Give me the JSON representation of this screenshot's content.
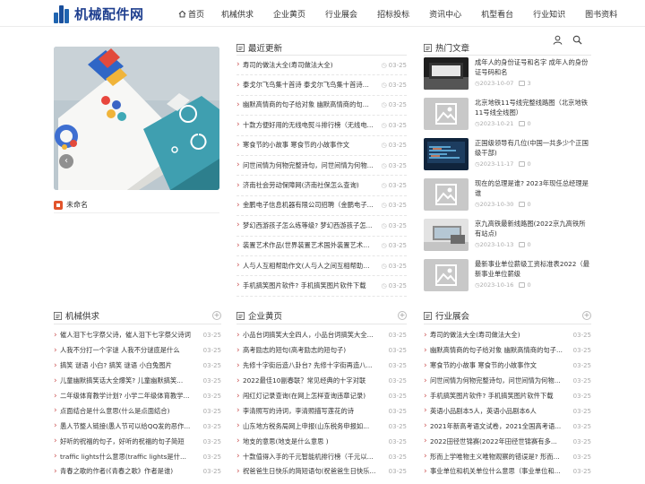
{
  "header": {
    "logo_text": "机械配件网",
    "nav": [
      "首页",
      "机械供求",
      "企业黄页",
      "行业展会",
      "招标投标",
      "资讯中心",
      "机型看台",
      "行业知识",
      "图书资料"
    ]
  },
  "slider": {
    "caption": "未命名"
  },
  "recent": {
    "title": "最近更新",
    "items": [
      {
        "title": "寿司的做法大全(寿司做法大全)",
        "date": "03-25"
      },
      {
        "title": "泰戈尔飞鸟集十首诗 泰戈尔飞鸟集十首诗朗诵",
        "date": "03-25"
      },
      {
        "title": "幽默高情商的句子给对象 幽默高情商的句子...",
        "date": "03-25"
      },
      {
        "title": "十款方便好用的无线电熨斗排行榜（无线电...",
        "date": "03-25"
      },
      {
        "title": "寒食节的小故事 寒食节的小故事作文",
        "date": "03-25"
      },
      {
        "title": "问世间情为何物完整诗句，问世间情为何物...",
        "date": "03-25"
      },
      {
        "title": "济南社会劳动保障网(济南社保怎么查询)",
        "date": "03-25"
      },
      {
        "title": "金鹏电子信息机器有限公司招聘（金鹏电子...",
        "date": "03-25"
      },
      {
        "title": "梦幻西游孩子怎么练等级? 梦幻西游孩子怎...",
        "date": "03-25"
      },
      {
        "title": "装置艺术作品(世界装置艺术国外装置艺术作...",
        "date": "03-25"
      },
      {
        "title": "人与人互相帮助作文(人与人之间互相帮助的...",
        "date": "03-25"
      },
      {
        "title": "手机搞笑图片软件? 手机搞笑图片软件下载",
        "date": "03-25"
      }
    ]
  },
  "hot": {
    "title": "热门文章",
    "items": [
      {
        "title": "成年人的身份证号和名字 成年人的身份证号码和名",
        "date": "2023-10-07",
        "comments": "3"
      },
      {
        "title": "北京地铁11号线完整线路图（北京地铁11号线全线图）",
        "date": "2023-10-21",
        "comments": "0"
      },
      {
        "title": "正国级领导有几位(中国一共多少个正国级干部)",
        "date": "2023-11-17",
        "comments": "0"
      },
      {
        "title": "现在的总理是谁? 2023年现任总经理是谁",
        "date": "2023-10-30",
        "comments": "0"
      },
      {
        "title": "京九高铁最新线路图(2022京九高铁所有站点)",
        "date": "2023-10-13",
        "comments": "0"
      },
      {
        "title": "最新事业单位薪级工资标准表2022（最新事业单位薪级",
        "date": "2023-10-16",
        "comments": "0"
      }
    ]
  },
  "sections": [
    {
      "title": "机械供求",
      "items": [
        {
          "title": "催人泪下七字祭父诗，催人泪下七字祭父诗词",
          "date": "03-25"
        },
        {
          "title": "人我不分打一个字谜 人我不分谜底是什么",
          "date": "03-25"
        },
        {
          "title": "搞笑 谜语 小白? 搞笑 谜语 小白兔图片",
          "date": "03-25"
        },
        {
          "title": "儿童幽默搞笑话大全爆笑? 儿童幽默搞笑...",
          "date": "03-25"
        },
        {
          "title": "二年级体育教学计划? 小学二年级体育教学...",
          "date": "03-25"
        },
        {
          "title": "点面结合是什么意思(什么是点面结合)",
          "date": "03-25"
        },
        {
          "title": "愚人节整人链接(愚人节可以给QQ发的恶作...",
          "date": "03-25"
        },
        {
          "title": "好听的祝福的句子，好听的祝福的句子简短",
          "date": "03-25"
        },
        {
          "title": "traffic lights什么意思(traffic lights是什...",
          "date": "03-25"
        },
        {
          "title": "青春之歌的作者(《青春之歌》作者是谁)",
          "date": "03-25"
        }
      ]
    },
    {
      "title": "企业黄页",
      "items": [
        {
          "title": "小品台词搞笑大全四人，小品台词搞笑大全...",
          "date": "03-25"
        },
        {
          "title": "高考励志的短句(高考励志的短句子)",
          "date": "03-25"
        },
        {
          "title": "先修十字街后造八卦台? 先修十字街再造八...",
          "date": "03-25"
        },
        {
          "title": "2022最佳10副春联？常见经典的十字对联",
          "date": "03-25"
        },
        {
          "title": "闯红灯记录查询(在网上怎样查询违章记录)",
          "date": "03-25"
        },
        {
          "title": "李清照写的诗词，李清照描写莲花的诗",
          "date": "03-25"
        },
        {
          "title": "山东地方税务局网上申报(山东税务申报如...",
          "date": "03-25"
        },
        {
          "title": "地支的意思(地支是什么意思 )",
          "date": "03-25"
        },
        {
          "title": "十款值得入手的千元智能机排行榜（千元以...",
          "date": "03-25"
        },
        {
          "title": "祝爸爸生日快乐的简短语句(祝爸爸生日快乐...",
          "date": "03-25"
        }
      ]
    },
    {
      "title": "行业展会",
      "items": [
        {
          "title": "寿司的做法大全(寿司做法大全)",
          "date": "03-25"
        },
        {
          "title": "幽默高情商的句子给对象 幽默高情商的句子...",
          "date": "03-25"
        },
        {
          "title": "寒食节的小故事 寒食节的小故事作文",
          "date": "03-25"
        },
        {
          "title": "问世间情为何物完整诗句，问世间情为何物...",
          "date": "03-25"
        },
        {
          "title": "手机搞笑图片软件? 手机搞笑图片软件下载",
          "date": "03-25"
        },
        {
          "title": "英语小品剧本5人，英语小品剧本6人",
          "date": "03-25"
        },
        {
          "title": "2021年新高考语文试卷，2021全国高考语...",
          "date": "03-25"
        },
        {
          "title": "2022田径世锦赛(2022年田径世锦赛有多...",
          "date": "03-25"
        },
        {
          "title": "形而上学唯物主义唯物观察的错误是? 形而上...",
          "date": "03-25"
        },
        {
          "title": "事业单位和机关单位什么意思（事业单位和...",
          "date": "03-25"
        }
      ]
    }
  ]
}
